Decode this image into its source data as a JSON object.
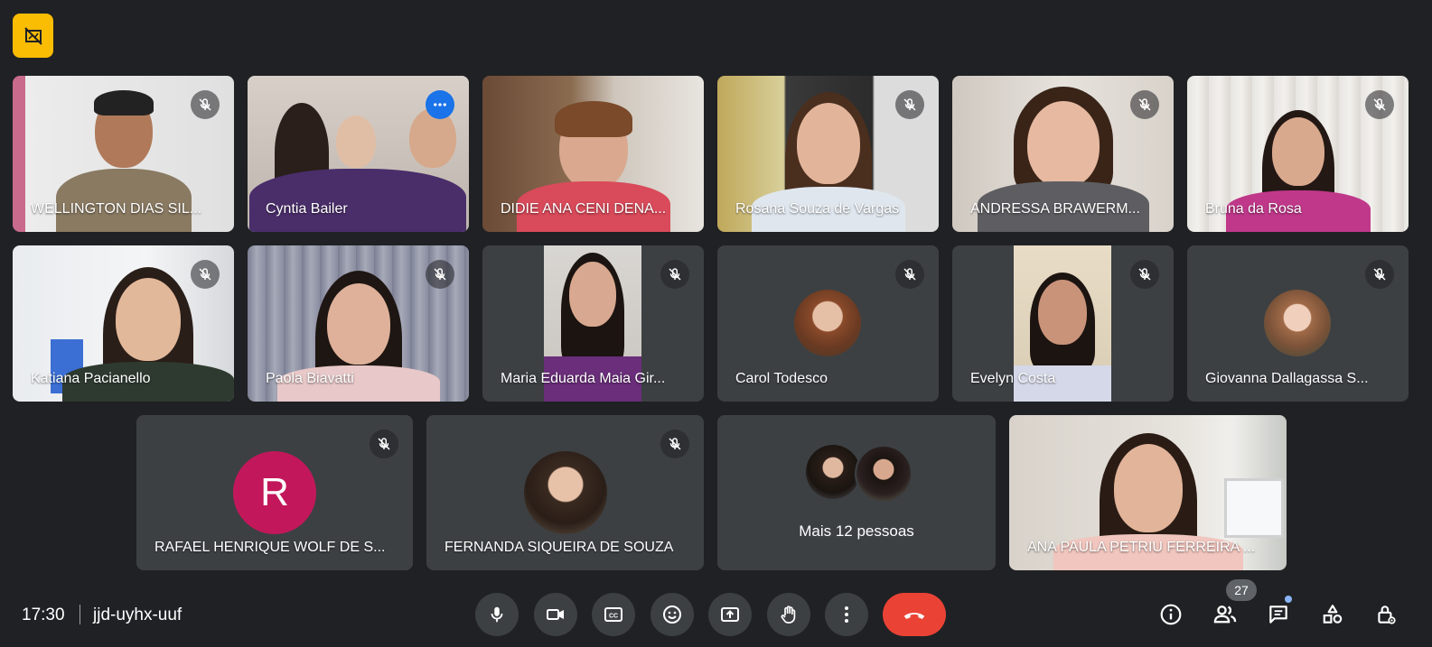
{
  "meeting": {
    "time": "17:30",
    "code": "jjd-uyhx-uuf"
  },
  "participants": [
    {
      "name": "WELLINGTON DIAS SIL...",
      "muted": true
    },
    {
      "name": "Cyntia Bailer",
      "muted": false,
      "active": true
    },
    {
      "name": "DIDIE ANA CENI DENA...",
      "muted": false
    },
    {
      "name": "Rosana Souza de Vargas",
      "muted": true
    },
    {
      "name": "ANDRESSA BRAWERM...",
      "muted": true
    },
    {
      "name": "Bruna da Rosa",
      "muted": true
    },
    {
      "name": "Katiana Pacianello",
      "muted": true
    },
    {
      "name": "Paola Biavatti",
      "muted": true
    },
    {
      "name": "Maria Eduarda Maia Gir...",
      "muted": true
    },
    {
      "name": "Carol Todesco",
      "muted": true
    },
    {
      "name": "Evelyn Costa",
      "muted": true
    },
    {
      "name": "Giovanna Dallagassa S...",
      "muted": true
    },
    {
      "name": "RAFAEL HENRIQUE WOLF DE S...",
      "muted": true,
      "avatar_letter": "R"
    },
    {
      "name": "FERNANDA SIQUEIRA DE SOUZA",
      "muted": true
    },
    {
      "name": "ANA PAULA PETRIU FERREIRA ...",
      "muted": false
    }
  ],
  "more_people_label": "Mais 12 pessoas",
  "participant_count": "27",
  "controls": [
    "mic-icon",
    "camera-icon",
    "captions-icon",
    "emoji-icon",
    "present-icon",
    "raise-hand-icon",
    "more-options-icon",
    "end-call-icon"
  ],
  "right_controls": [
    "info-icon",
    "people-icon",
    "chat-icon",
    "activities-icon",
    "host-controls-icon"
  ],
  "colors": {
    "background": "#202124",
    "tile": "#3c4043",
    "accent": "#8ab4f8",
    "end_call": "#ea4335",
    "badge": "#fbbc04"
  }
}
